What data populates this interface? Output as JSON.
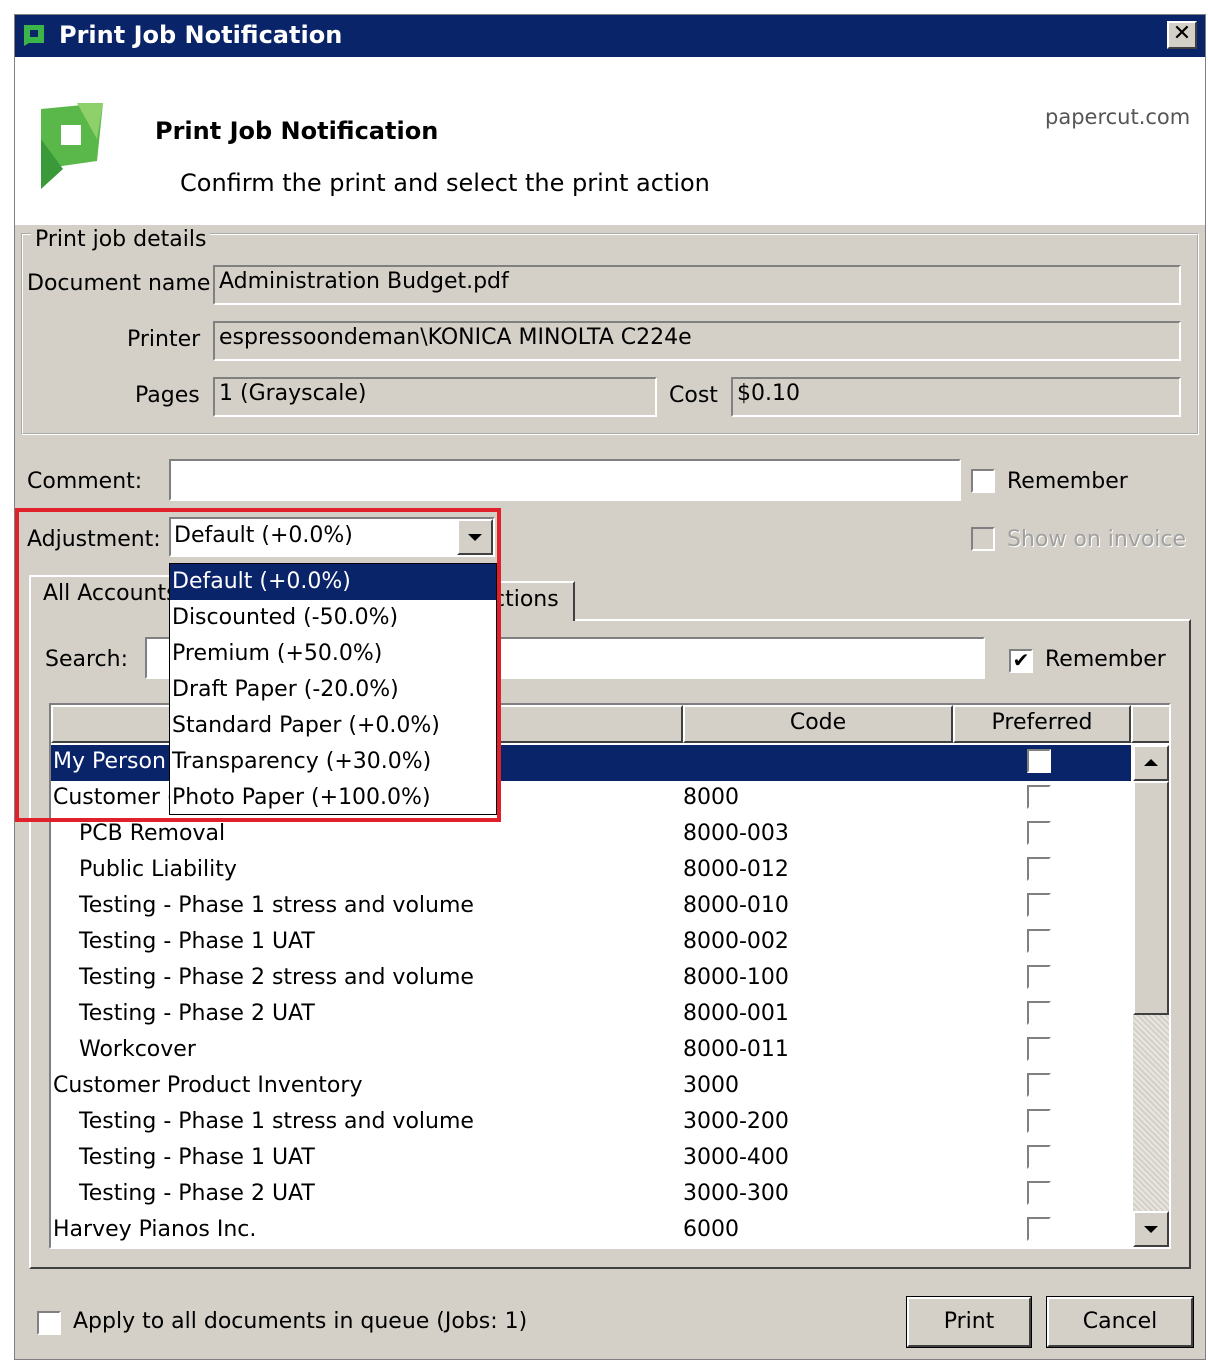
{
  "window": {
    "title": "Print Job Notification",
    "close_glyph": "✕"
  },
  "header": {
    "title": "Print Job Notification",
    "subtitle": "Confirm the print and select the print action",
    "site": "papercut.com"
  },
  "details": {
    "legend": "Print job details",
    "document_label": "Document name",
    "document_value": "Administration Budget.pdf",
    "printer_label": "Printer",
    "printer_value": "espressoondeman\\KONICA MINOLTA C224e",
    "pages_label": "Pages",
    "pages_value": "1  (Grayscale)",
    "cost_label": "Cost",
    "cost_value": "$0.10"
  },
  "comment": {
    "label": "Comment:",
    "value": "",
    "remember_label": "Remember",
    "remember_checked": false
  },
  "adjustment": {
    "label": "Adjustment:",
    "selected": "Default (+0.0%)",
    "show_on_invoice_label": "Show on invoice",
    "options": [
      "Default (+0.0%)",
      "Discounted (-50.0%)",
      "Premium (+50.0%)",
      "Draft Paper (-20.0%)",
      "Standard Paper (+0.0%)",
      "Transparency (+30.0%)",
      "Photo Paper (+100.0%)"
    ]
  },
  "tabs": {
    "all_accounts": "All Accounts",
    "second_tab_visible": "ctions"
  },
  "search": {
    "label": "Search:",
    "value": "",
    "remember_label": "Remember",
    "remember_checked": true
  },
  "table": {
    "columns": [
      "",
      "Code",
      "Preferred"
    ],
    "rows": [
      {
        "name": "My Person",
        "code": "",
        "indent": false,
        "selected": true
      },
      {
        "name": "Customer (",
        "code": "8000",
        "indent": false,
        "selected": false
      },
      {
        "name": "PCB Removal",
        "code": "8000-003",
        "indent": true,
        "selected": false
      },
      {
        "name": "Public Liability",
        "code": "8000-012",
        "indent": true,
        "selected": false
      },
      {
        "name": "Testing - Phase 1 stress and volume",
        "code": "8000-010",
        "indent": true,
        "selected": false
      },
      {
        "name": "Testing - Phase 1 UAT",
        "code": "8000-002",
        "indent": true,
        "selected": false
      },
      {
        "name": "Testing - Phase 2 stress and volume",
        "code": "8000-100",
        "indent": true,
        "selected": false
      },
      {
        "name": "Testing - Phase 2 UAT",
        "code": "8000-001",
        "indent": true,
        "selected": false
      },
      {
        "name": "Workcover",
        "code": "8000-011",
        "indent": true,
        "selected": false
      },
      {
        "name": "Customer Product Inventory",
        "code": "3000",
        "indent": false,
        "selected": false
      },
      {
        "name": "Testing - Phase 1 stress and volume",
        "code": "3000-200",
        "indent": true,
        "selected": false
      },
      {
        "name": "Testing - Phase 1 UAT",
        "code": "3000-400",
        "indent": true,
        "selected": false
      },
      {
        "name": "Testing - Phase 2 UAT",
        "code": "3000-300",
        "indent": true,
        "selected": false
      },
      {
        "name": "Harvey Pianos Inc.",
        "code": "6000",
        "indent": false,
        "selected": false
      }
    ]
  },
  "footer": {
    "apply_all_label": "Apply to all documents in queue (Jobs: 1)",
    "apply_all_checked": false,
    "print_button": "Print",
    "cancel_button": "Cancel"
  },
  "colors": {
    "titlebar": "#0a246a",
    "selection": "#0a246a",
    "face": "#d4d0c8",
    "highlight_box": "#e0202a"
  }
}
